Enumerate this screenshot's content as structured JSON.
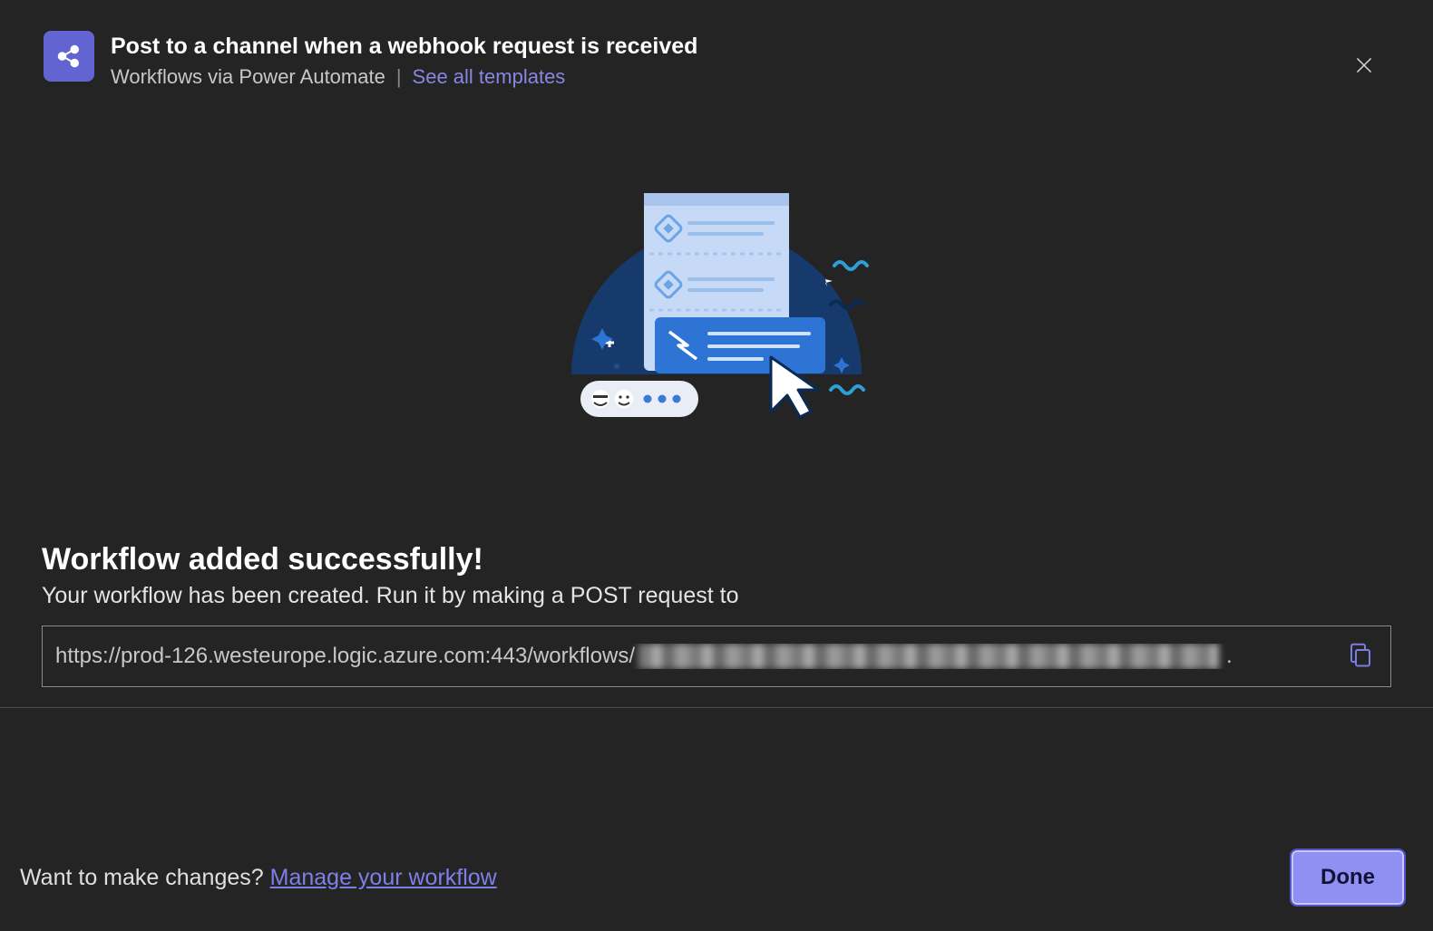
{
  "header": {
    "title": "Post to a channel when a webhook request is received",
    "subtitle": "Workflows via Power Automate",
    "see_all_link": "See all templates"
  },
  "content": {
    "success_title": "Workflow added successfully!",
    "success_desc": "Your workflow has been created. Run it by making a POST request to",
    "url_visible": "https://prod-126.westeurope.logic.azure.com:443/workflows/"
  },
  "footer": {
    "changes_text": "Want to make changes? ",
    "manage_link": "Manage your workflow",
    "done_label": "Done"
  },
  "icons": {
    "share": "share-icon",
    "close": "close-icon",
    "copy": "copy-icon"
  },
  "colors": {
    "accent": "#6264d2",
    "link": "#8887e2",
    "done_bg": "#8f90f1"
  }
}
